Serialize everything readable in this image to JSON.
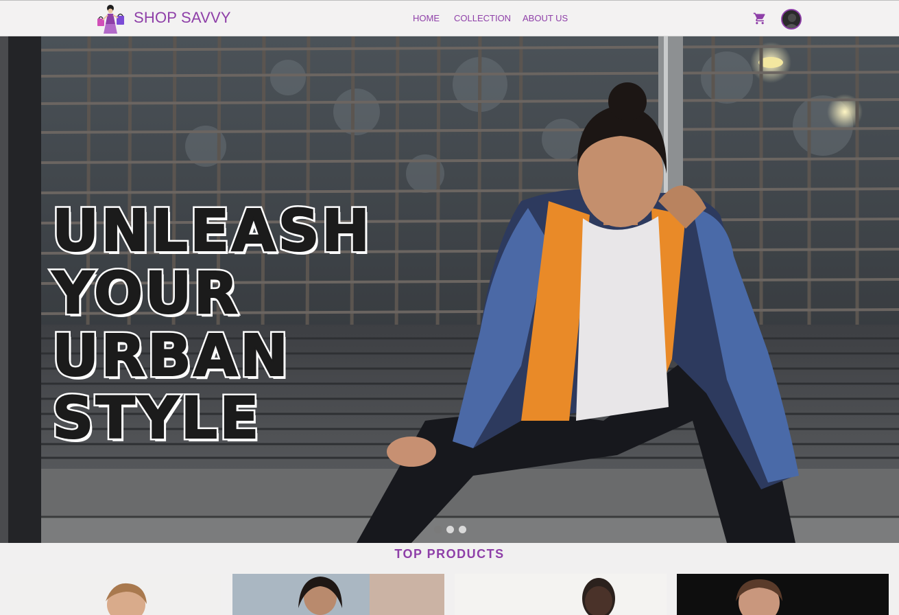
{
  "brand": {
    "name": "SHOP SAVVY",
    "logo_icon": "shopping-woman-logo"
  },
  "nav": {
    "items": [
      {
        "label": "HOME"
      },
      {
        "label": "COLLECTION"
      },
      {
        "label": "ABOUT US"
      }
    ],
    "cart_icon": "cart-icon",
    "avatar_icon": "user-avatar"
  },
  "hero": {
    "title": "UNLEASH\nYOUR\nURBAN\nSTYLE",
    "carousel": {
      "slide_count": 3,
      "active_index": 0
    }
  },
  "products": {
    "heading": "TOP PRODUCTS",
    "cards": [
      {
        "icon": "product-image"
      },
      {
        "icon": "product-image"
      },
      {
        "icon": "product-image"
      },
      {
        "icon": "product-image"
      }
    ]
  },
  "colors": {
    "accent": "#8e3fa8",
    "header_bg": "#f3f2f2",
    "page_bg": "#f1f0f0"
  }
}
